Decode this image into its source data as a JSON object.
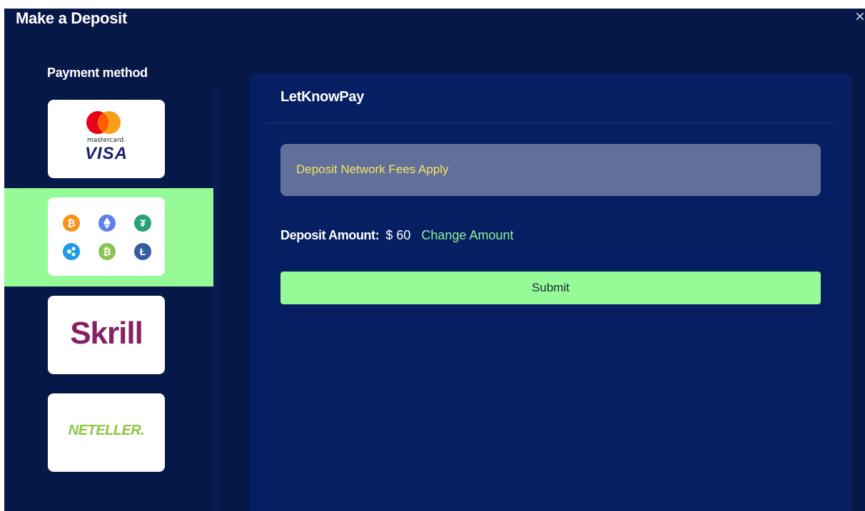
{
  "modal": {
    "title": "Make a Deposit",
    "close_icon": "close-icon",
    "close_glyph": "×"
  },
  "sidebar": {
    "label": "Payment method",
    "selected": "crypto",
    "methods": [
      {
        "id": "card",
        "lines": [
          "mastercard.",
          "VISA"
        ]
      },
      {
        "id": "crypto",
        "coins": [
          "bitcoin",
          "ethereum",
          "tether",
          "ripple",
          "bitcoin-cash",
          "litecoin"
        ]
      },
      {
        "id": "skrill",
        "logo_text": "Skrill"
      },
      {
        "id": "neteller",
        "logo_text": "NETELLER."
      }
    ]
  },
  "main": {
    "title": "LetKnowPay",
    "notice": "Deposit Network Fees Apply",
    "amount_label": "Deposit Amount:",
    "amount_value": "$ 60",
    "change_link": "Change Amount",
    "submit_label": "Submit"
  },
  "colors": {
    "background": "#061848",
    "panel": "#061f62",
    "accent_green": "#96fa96",
    "link_green": "#8ff495",
    "notice_bg": "#61709b",
    "notice_text": "#f7e45b"
  }
}
